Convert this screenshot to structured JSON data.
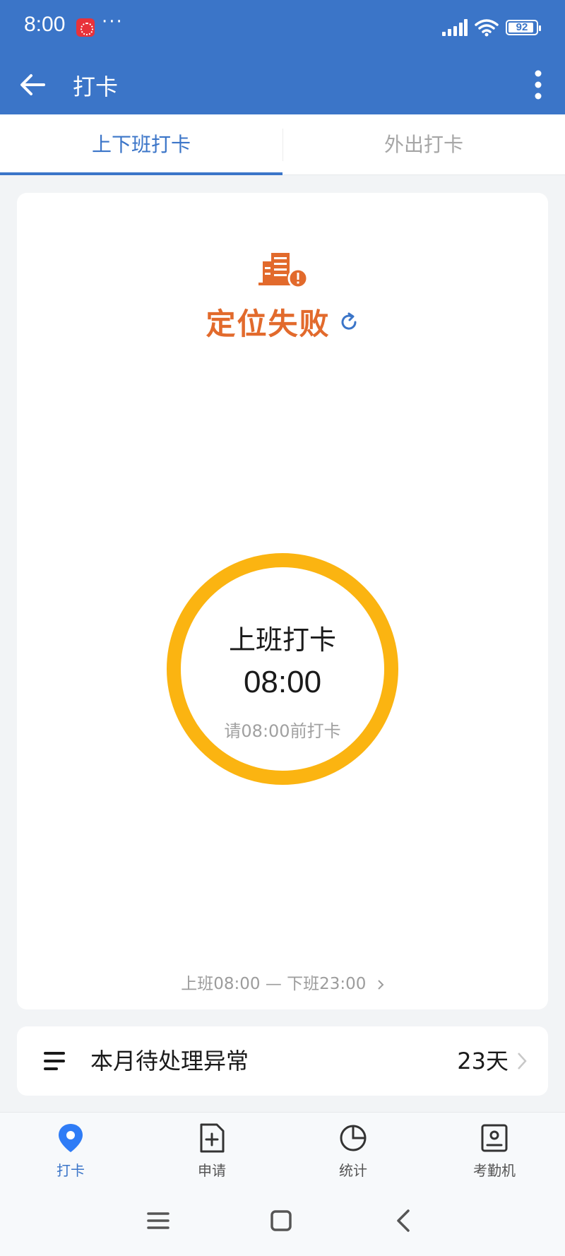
{
  "status_bar": {
    "time": "8:00",
    "more": "···",
    "battery": "92",
    "battery_level": 0.92
  },
  "app_bar": {
    "title": "打卡",
    "back_icon": "arrow-left-icon",
    "menu_icon": "more-vertical-icon"
  },
  "tabs": [
    {
      "label": "上下班打卡",
      "active": true
    },
    {
      "label": "外出打卡",
      "active": false
    }
  ],
  "location": {
    "status_text": "定位失败",
    "icon": "building-alert-icon",
    "refresh_icon": "refresh-icon"
  },
  "punch": {
    "label": "上班打卡",
    "time": "08:00",
    "hint": "请08:00前打卡",
    "ring_color": "#fbb411"
  },
  "shift": {
    "text": "上班08:00 — 下班23:00"
  },
  "anomaly": {
    "label": "本月待处理异常",
    "count": "23天",
    "icon": "list-icon"
  },
  "bottom_nav": [
    {
      "label": "打卡",
      "icon": "location-pin-icon",
      "active": true
    },
    {
      "label": "申请",
      "icon": "add-document-icon",
      "active": false
    },
    {
      "label": "统计",
      "icon": "pie-chart-icon",
      "active": false
    },
    {
      "label": "考勤机",
      "icon": "attendance-device-icon",
      "active": false
    }
  ],
  "colors": {
    "brand": "#3b75c8",
    "warning": "#e26a2c",
    "ring": "#fbb411"
  }
}
